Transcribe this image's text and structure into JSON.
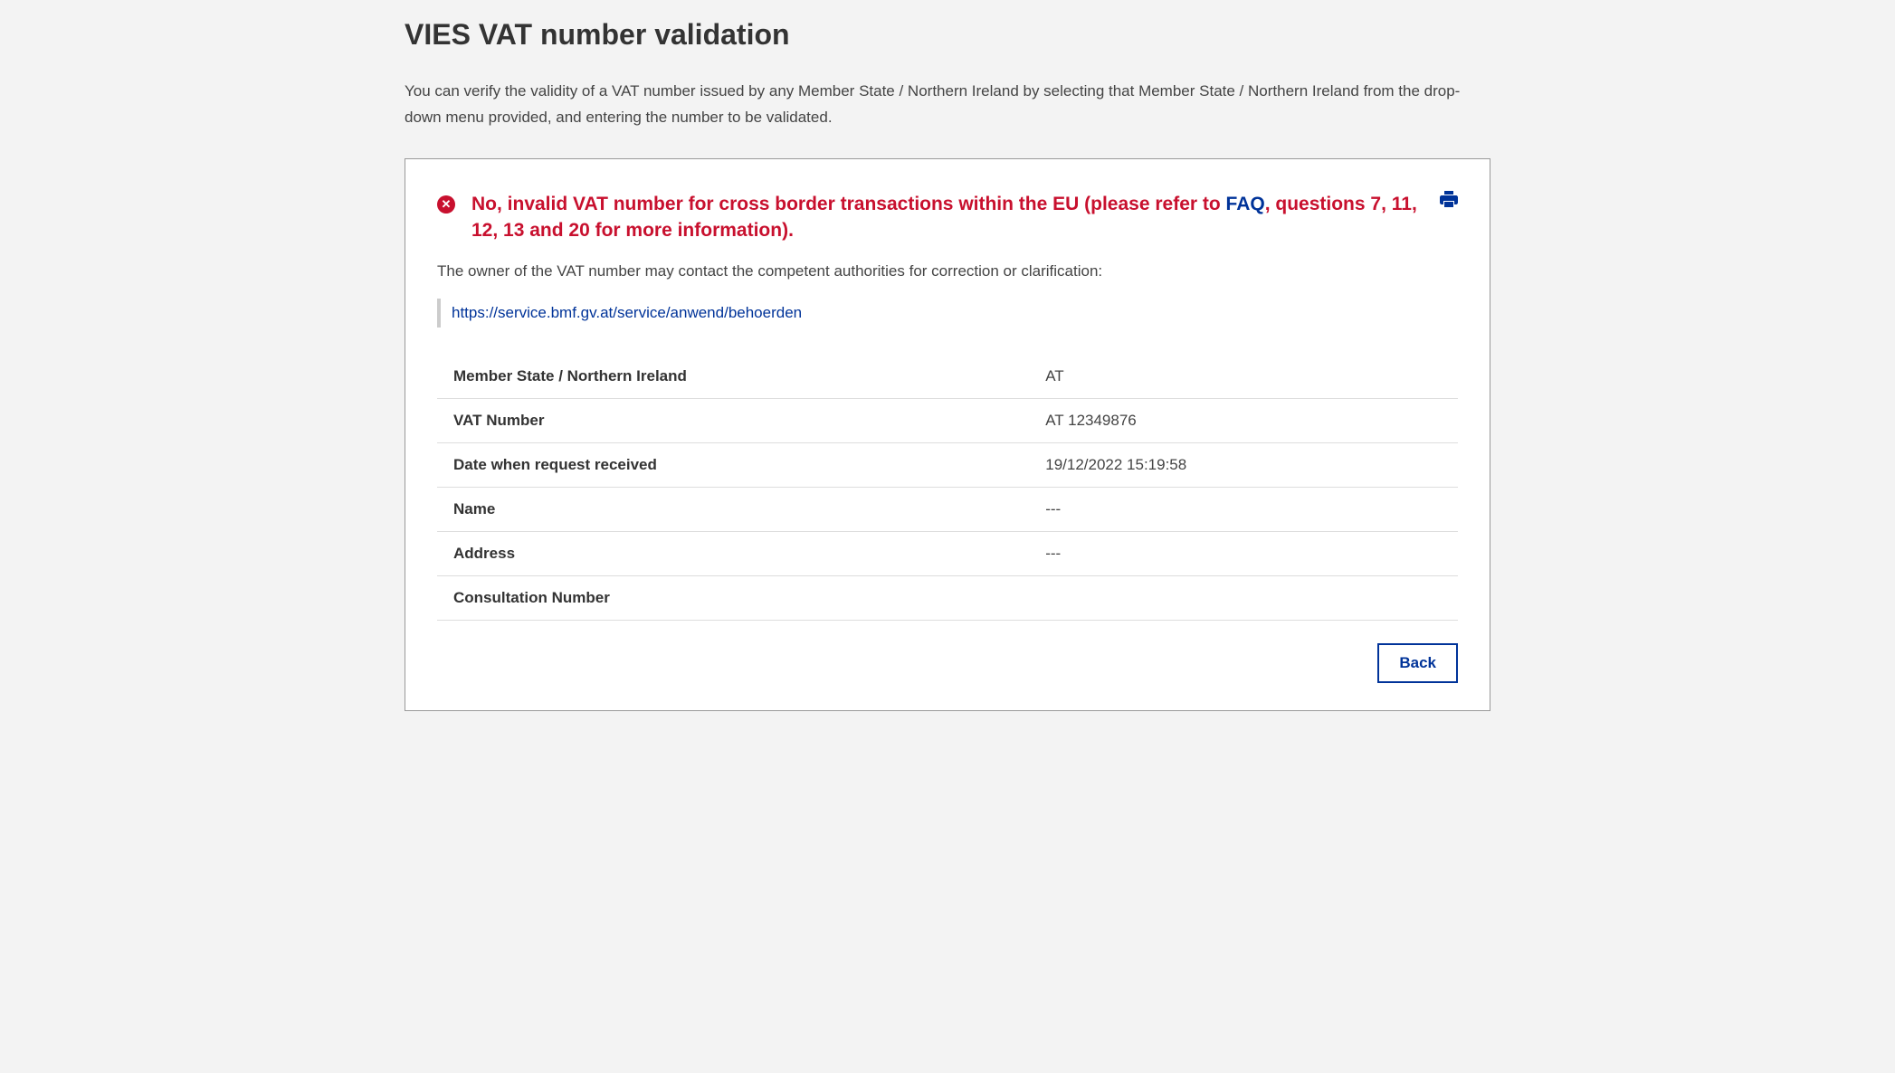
{
  "page": {
    "title": "VIES VAT number validation",
    "intro": "You can verify the validity of a VAT number issued by any Member State / Northern Ireland by selecting that Member State / Northern Ireland from the drop-down menu provided, and entering the number to be validated."
  },
  "result": {
    "error_prefix": "No, invalid VAT number for cross border transactions within the EU (please refer to ",
    "faq_label": "FAQ",
    "error_suffix": ", questions 7, 11, 12, 13 and 20 for more information).",
    "owner_note": "The owner of the VAT number may contact the competent authorities for correction or clarification:",
    "authority_link": "https://service.bmf.gv.at/service/anwend/behoerden"
  },
  "details": {
    "rows": [
      {
        "label": "Member State / Northern Ireland",
        "value": "AT"
      },
      {
        "label": "VAT Number",
        "value": "AT 12349876"
      },
      {
        "label": "Date when request received",
        "value": "19/12/2022 15:19:58"
      },
      {
        "label": "Name",
        "value": "---"
      },
      {
        "label": "Address",
        "value": "---"
      },
      {
        "label": "Consultation Number",
        "value": ""
      }
    ]
  },
  "buttons": {
    "back": "Back"
  }
}
